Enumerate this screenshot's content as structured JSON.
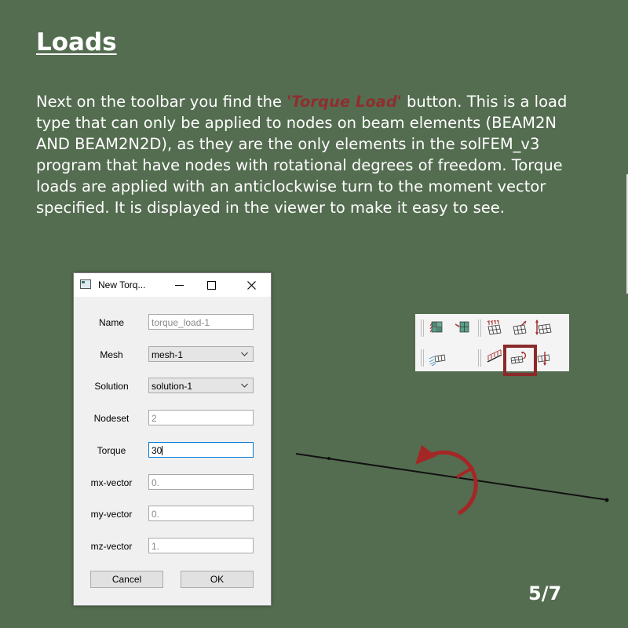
{
  "slide": {
    "title": "Loads",
    "intro_before": "Next on the toolbar you find the ",
    "intro_highlight": "'Torque Load'",
    "intro_after": " button. This is a load type that can only be applied to nodes on beam elements (BEAM2N AND BEAM2N2D), as they are the only elements in the solFEM_v3 program that have nodes with rotational degrees of freedom. Torque loads are applied with an anticlockwise turn to the moment vector specified. It is displayed in the viewer to make it easy to see.",
    "page": "5/7"
  },
  "dialog": {
    "title": "New Torq...",
    "name_label": "Name",
    "name_placeholder": "torque_load-1",
    "mesh_label": "Mesh",
    "mesh_value": "mesh-1",
    "solution_label": "Solution",
    "solution_value": "solution-1",
    "nodeset_label": "Nodeset",
    "nodeset_placeholder": "2",
    "torque_label": "Torque",
    "torque_value": "30",
    "mx_label": "mx-vector",
    "mx_placeholder": "0.",
    "my_label": "my-vector",
    "my_placeholder": "0.",
    "mz_label": "mz-vector",
    "mz_placeholder": "1.",
    "cancel_label": "Cancel",
    "ok_label": "OK"
  },
  "toolbar": {
    "icons": [
      "mesh-fixed-icon",
      "mesh-support-icon",
      "fixed-support-icon",
      "pinned-support-icon",
      "roller-support-icon",
      "distributed-load-icon",
      "beam-load-icon",
      "torque-load-icon",
      "point-load-icon"
    ]
  },
  "colors": {
    "background": "#546d50",
    "highlight": "#8e2f2f",
    "torque_arrow": "#a52626",
    "beam": "#111111"
  }
}
